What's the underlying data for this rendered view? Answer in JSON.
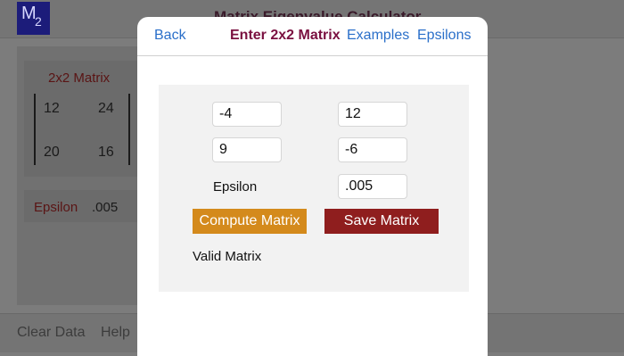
{
  "background": {
    "logo": {
      "letter": "M",
      "subscript": "2"
    },
    "title": "Matrix Eigenvalue Calculator",
    "matrix_card": {
      "title": "2x2 Matrix",
      "cells": [
        "12",
        "24",
        "20",
        "16"
      ]
    },
    "epsilon_row": {
      "label": "Epsilon",
      "value": ".005"
    },
    "footer": {
      "items": [
        "Clear Data",
        "Help"
      ]
    }
  },
  "modal": {
    "nav": {
      "back_label": "Back",
      "title": "Enter 2x2 Matrix",
      "examples_label": "Examples",
      "epsilons_label": "Epsilons"
    },
    "form": {
      "a11": "-4",
      "a12": "12",
      "a21": "9",
      "a22": "-6",
      "epsilon_label": "Epsilon",
      "epsilon_value": ".005",
      "compute_label": "Compute Matrix",
      "save_label": "Save Matrix",
      "status_text": "Valid Matrix"
    }
  },
  "colors": {
    "accent_link": "#2a6fc9",
    "title_color": "#7a1040",
    "compute_button": "#d48a1c",
    "save_button": "#8f1e1e"
  }
}
